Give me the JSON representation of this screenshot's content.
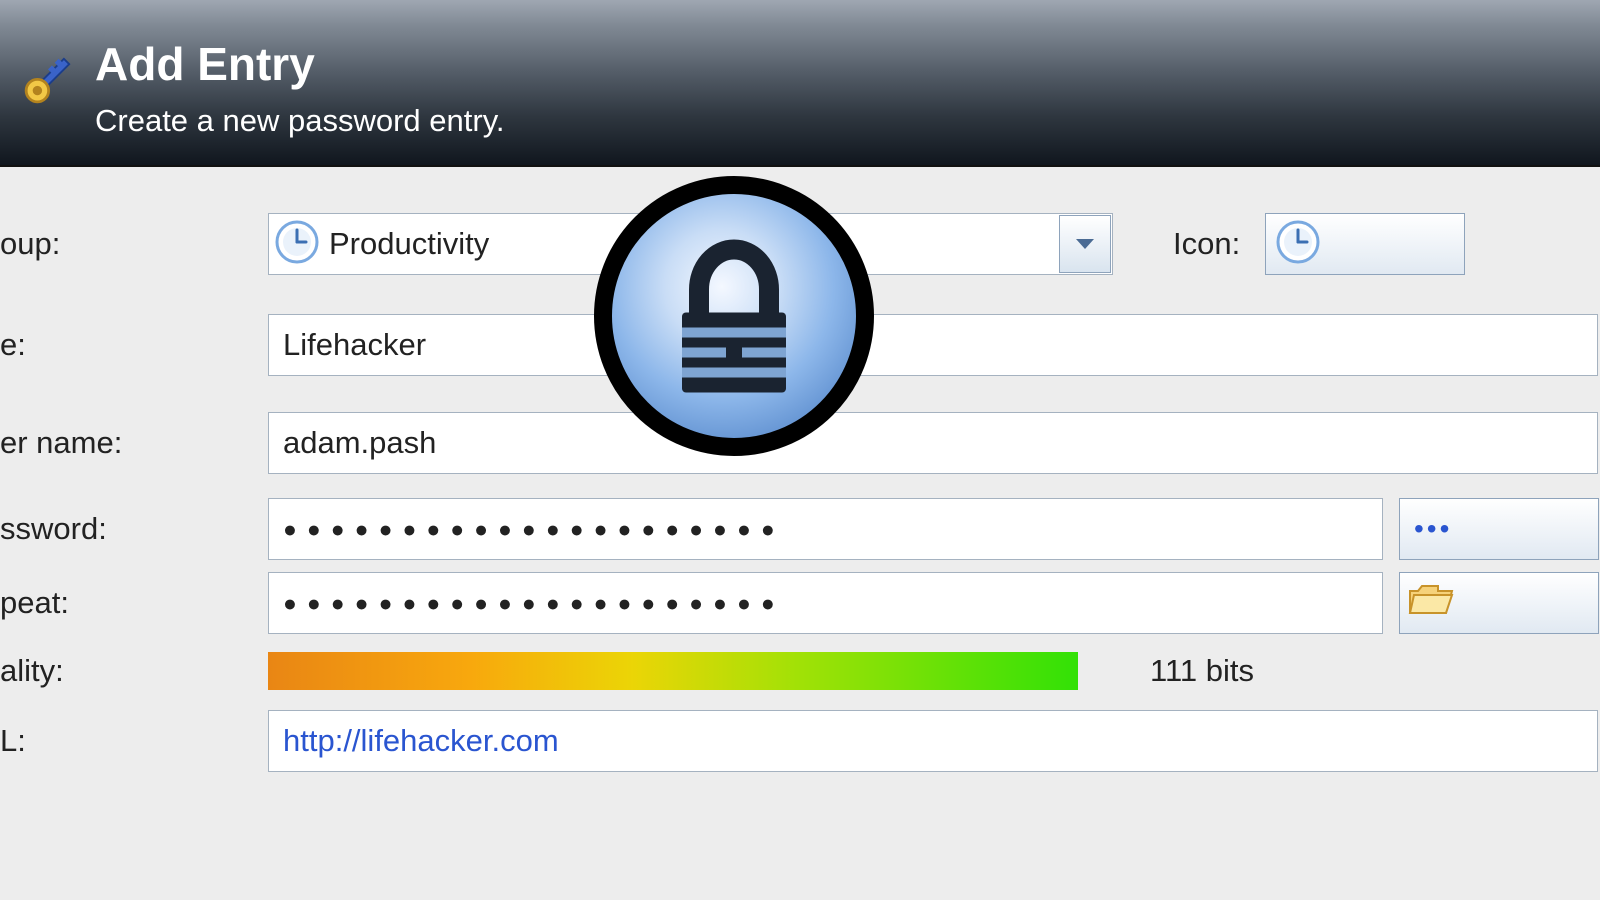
{
  "header": {
    "title": "Add Entry",
    "subtitle": "Create a new password entry."
  },
  "labels": {
    "group": "oup:",
    "title": "e:",
    "username": "er name:",
    "password": "ssword:",
    "repeat": "peat:",
    "quality": "ality:",
    "url": "L:",
    "icon": "Icon:"
  },
  "values": {
    "group": "Productivity",
    "title": "Lifehacker",
    "username": "adam.pash",
    "password_mask": "●●●●●●●●●●●●●●●●●●●●●",
    "repeat_mask": "●●●●●●●●●●●●●●●●●●●●●",
    "quality": "111 bits",
    "url": "http://lifehacker.com",
    "reveal_glyph": "•••"
  }
}
